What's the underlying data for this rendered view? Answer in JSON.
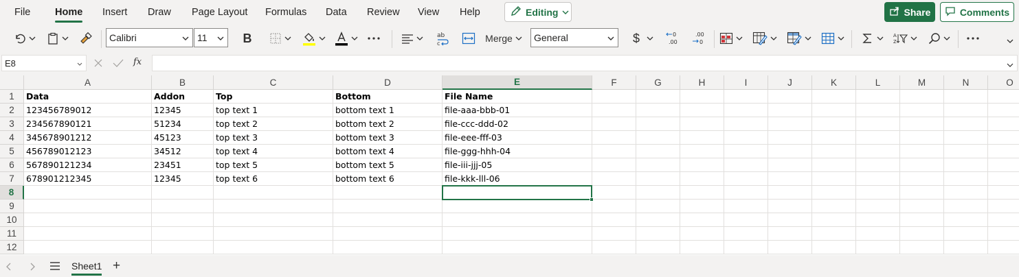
{
  "menu": {
    "tabs": [
      "File",
      "Home",
      "Insert",
      "Draw",
      "Page Layout",
      "Formulas",
      "Data",
      "Review",
      "View",
      "Help"
    ],
    "active": "Home",
    "editing_label": "Editing",
    "share_label": "Share",
    "comments_label": "Comments"
  },
  "toolbar": {
    "font_name": "Calibri",
    "font_size": "11",
    "bold_label": "B",
    "merge_label": "Merge",
    "number_format": "General",
    "currency_symbol": "$",
    "decrease_decimal_label": "←0\n.00",
    "increase_decimal_label": ".00\n→0"
  },
  "formula_bar": {
    "name_box": "E8",
    "fx_label": "fx",
    "formula_value": ""
  },
  "sheet": {
    "columns": [
      "A",
      "B",
      "C",
      "D",
      "E",
      "F",
      "G",
      "H",
      "I",
      "J",
      "K",
      "L",
      "M",
      "N",
      "O"
    ],
    "rows": [
      "1",
      "2",
      "3",
      "4",
      "5",
      "6",
      "7",
      "8",
      "9",
      "10",
      "11",
      "12"
    ],
    "selected_cell": "E8",
    "cells": [
      [
        "Data",
        "Addon",
        "Top",
        "Bottom",
        "File Name"
      ],
      [
        "123456789012",
        "12345",
        "top text 1",
        "bottom text 1",
        "file-aaa-bbb-01"
      ],
      [
        "234567890121",
        "51234",
        "top text 2",
        "bottom text 2",
        "file-ccc-ddd-02"
      ],
      [
        "345678901212",
        "45123",
        "top text 3",
        "bottom text 3",
        "file-eee-fff-03"
      ],
      [
        "456789012123",
        "34512",
        "top text 4",
        "bottom text 4",
        "file-ggg-hhh-04"
      ],
      [
        "567890121234",
        "23451",
        "top text 5",
        "bottom text 5",
        "file-iii-jjj-05"
      ],
      [
        "678901212345",
        "12345",
        "top text 6",
        "bottom text 6",
        "file-kkk-lll-06"
      ]
    ]
  },
  "sheet_tabs": {
    "tabs": [
      "Sheet1"
    ],
    "add_label": "+"
  },
  "colors": {
    "accent": "#217346",
    "fill_color_bar": "#ffff00",
    "font_color_bar": "#000000"
  }
}
